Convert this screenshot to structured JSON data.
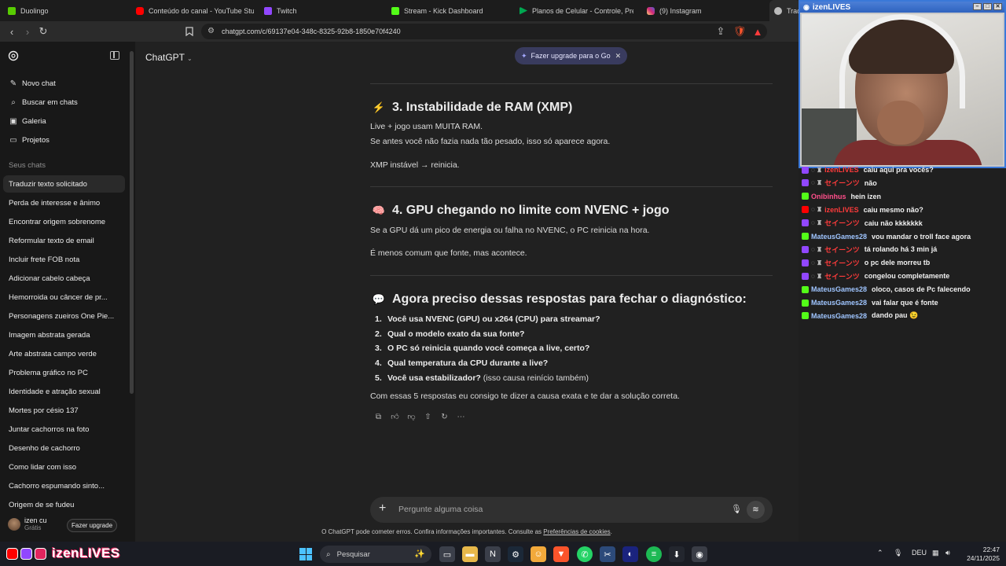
{
  "browser": {
    "tabs": [
      {
        "label": "Duolingo",
        "color": "#58cc02"
      },
      {
        "label": "Conteúdo do canal - YouTube Studio",
        "color": "#ff0000"
      },
      {
        "label": "Twitch",
        "color": "#9147ff"
      },
      {
        "label": "Stream - Kick Dashboard",
        "color": "#53fc18"
      },
      {
        "label": "Planos de Celular - Controle, Pré e P",
        "color": "#00a650"
      },
      {
        "label": "(9) Instagram",
        "color": "#e1306c"
      },
      {
        "label": "Trad",
        "color": "#cccccc"
      }
    ],
    "url": "chatgpt.com/c/69137e04-348c-8325-92b8-1850e70f4240"
  },
  "sidebar": {
    "actions": [
      {
        "label": "Novo chat",
        "icon": "new-chat-icon"
      },
      {
        "label": "Buscar em chats",
        "icon": "search-icon"
      },
      {
        "label": "Galeria",
        "icon": "gallery-icon"
      },
      {
        "label": "Projetos",
        "icon": "folder-icon"
      }
    ],
    "heading": "Seus chats",
    "chats": [
      "Traduzir texto solicitado",
      "Perda de interesse e ânimo",
      "Encontrar origem sobrenome",
      "Reformular texto de email",
      "Incluir frete FOB nota",
      "Adicionar cabelo cabeça",
      "Hemorroida ou câncer de pr...",
      "Personagens zueiros One Pie...",
      "Imagem abstrata gerada",
      "Arte abstrata campo verde",
      "Problema gráfico no PC",
      "Identidade e atração sexual",
      "Mortes por césio 137",
      "Juntar cachorros na foto",
      "Desenho de cachorro",
      "Como lidar com isso",
      "Cachorro espumando sinto...",
      "Origem de se fudeu"
    ],
    "selected_index": 0,
    "user": {
      "name": "izen cu",
      "plan": "Grátis",
      "upgrade_label": "Fazer upgrade"
    }
  },
  "main": {
    "model_label": "ChatGPT",
    "promo_label": "Fazer upgrade para o Go",
    "section3": {
      "emoji": "⚡",
      "title": "3. Instabilidade de RAM (XMP)",
      "line1": "Live + jogo usam MUITA RAM.",
      "line2": "Se antes você não fazia nada tão pesado, isso só aparece agora.",
      "line3": "XMP instável → reinicia."
    },
    "section4": {
      "emoji": "🧠",
      "title": "4. GPU chegando no limite com NVENC + jogo",
      "line1": "Se a GPU dá um pico de energia ou falha no NVENC, o PC reinicia na hora.",
      "line2": "É menos comum que fonte, mas acontece."
    },
    "section5": {
      "emoji": "💬",
      "title": "Agora preciso dessas respostas para fechar o diagnóstico:",
      "questions": [
        {
          "n": "1.",
          "bold": "Você usa NVENC (GPU) ou x264 (CPU) para streamar?",
          "rest": ""
        },
        {
          "n": "2.",
          "bold": "Qual o modelo exato da sua fonte?",
          "rest": ""
        },
        {
          "n": "3.",
          "bold": "O PC só reinicia quando você começa a live, certo?",
          "rest": ""
        },
        {
          "n": "4.",
          "bold": "Qual temperatura da CPU durante a live?",
          "rest": ""
        },
        {
          "n": "5.",
          "bold": "Você usa estabilizador?",
          "rest": " (isso causa reinício também)"
        }
      ],
      "closing": "Com essas 5 respostas eu consigo te dizer a causa exata e te dar a solução correta."
    },
    "composer_placeholder": "Pergunte alguma coisa",
    "disclaimer": "O ChatGPT pode cometer erros. Confira informações importantes. Consulte as ",
    "disclaimer_link": "Preferências de cookies",
    "disclaimer_end": "."
  },
  "stream": {
    "cam_title": "izenLIVES",
    "chat": [
      {
        "platform": "twitch",
        "user": "izenLIVES",
        "color": "#ff3b3b",
        "msg": "caiu aqui pra vocês?"
      },
      {
        "platform": "twitch",
        "user": "セイーンツ",
        "color": "#ff3b3b",
        "msg": "não"
      },
      {
        "platform": "kick",
        "user": "Onibinhus",
        "color": "#ff4f8b",
        "msg": "hein izen"
      },
      {
        "platform": "yt",
        "user": "izenLIVES",
        "color": "#ff3b3b",
        "msg": "caiu mesmo não?"
      },
      {
        "platform": "twitch",
        "user": "セイーンツ",
        "color": "#ff3b3b",
        "msg": "caiu não kkkkkkk"
      },
      {
        "platform": "kick",
        "user": "MateusGames28",
        "color": "#9fc5ff",
        "msg": "vou mandar o troll face agora"
      },
      {
        "platform": "twitch",
        "user": "セイーンツ",
        "color": "#ff3b3b",
        "msg": "tá rolando há 3 min já"
      },
      {
        "platform": "twitch",
        "user": "セイーンツ",
        "color": "#ff3b3b",
        "msg": "o pc dele morreu tb"
      },
      {
        "platform": "twitch",
        "user": "セイーンツ",
        "color": "#ff3b3b",
        "msg": "congelou completamente"
      },
      {
        "platform": "kick",
        "user": "MateusGames28",
        "color": "#9fc5ff",
        "msg": "oloco, casos de Pc falecendo"
      },
      {
        "platform": "kick",
        "user": "MateusGames28",
        "color": "#9fc5ff",
        "msg": "vai falar que é fonte"
      },
      {
        "platform": "kick",
        "user": "MateusGames28",
        "color": "#9fc5ff",
        "msg": "dando pau 😉"
      }
    ]
  },
  "taskbar": {
    "brand": "izenLIVES",
    "search_label": "Pesquisar",
    "lang": "DEU",
    "time": "22:47",
    "date": "24/11/2025"
  }
}
